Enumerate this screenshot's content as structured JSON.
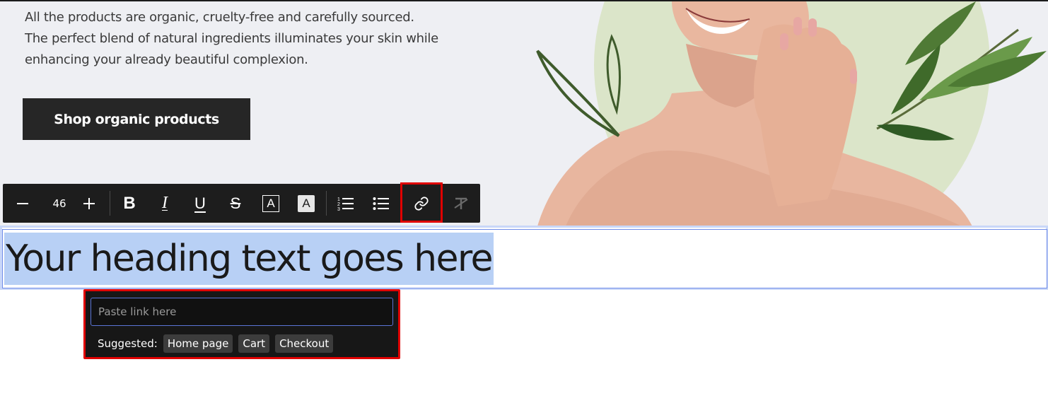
{
  "hero": {
    "text_lines": [
      "All the products are organic, cruelty-free and carefully sourced.",
      "The perfect blend of natural ingredients illuminates your skin while",
      "enhancing your already beautiful complexion."
    ],
    "cta_label": "Shop organic products"
  },
  "toolbar": {
    "font_size": "46",
    "buttons": {
      "decrease": "minus-icon",
      "increase": "plus-icon",
      "bold": "bold-icon",
      "italic": "italic-icon",
      "underline": "underline-icon",
      "strikethrough": "strikethrough-icon",
      "text_color": "text-color-icon",
      "highlight": "highlight-icon",
      "ordered_list": "ordered-list-icon",
      "bullet_list": "bullet-list-icon",
      "link": "link-icon",
      "clear_format": "clear-format-icon"
    }
  },
  "heading": {
    "text": "Your heading text goes here"
  },
  "link_popup": {
    "placeholder": "Paste link here",
    "suggested_label": "Suggested:",
    "suggestions": [
      "Home page",
      "Cart",
      "Checkout"
    ]
  },
  "colors": {
    "hero_bg": "#eeeff3",
    "toolbar_bg": "#1d1d1d",
    "selection": "#b8d0f5",
    "highlight_border": "#e00000",
    "input_border": "#5a74d6"
  }
}
